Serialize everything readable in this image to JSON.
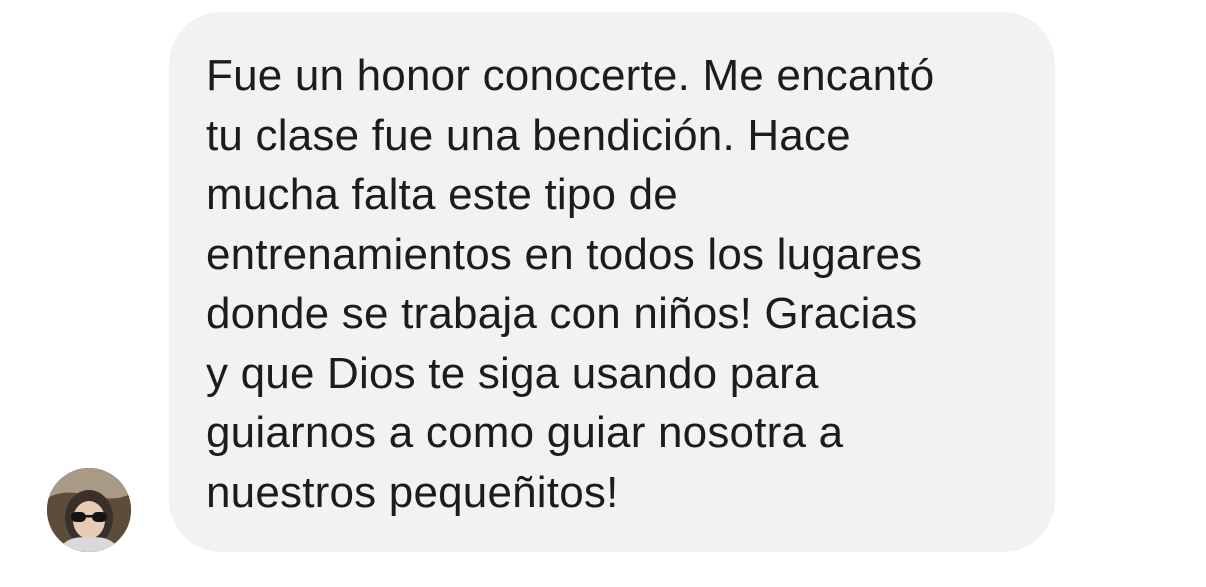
{
  "message": {
    "text": "Fue un honor conocerte. Me encantó\ntu clase fue una bendición. Hace\nmucha falta este tipo de\nentrenamientos en todos los lugares\ndonde se trabaja con niños! Gracias\ny que Dios te siga usando para\nguiarnos a como guiar nosotra a\nnuestros pequeñitos!"
  },
  "sender": {
    "avatar_icon": "profile-photo"
  },
  "colors": {
    "bubble": "#f2f2f4",
    "text": "#1c1c1e",
    "background": "#ffffff"
  }
}
